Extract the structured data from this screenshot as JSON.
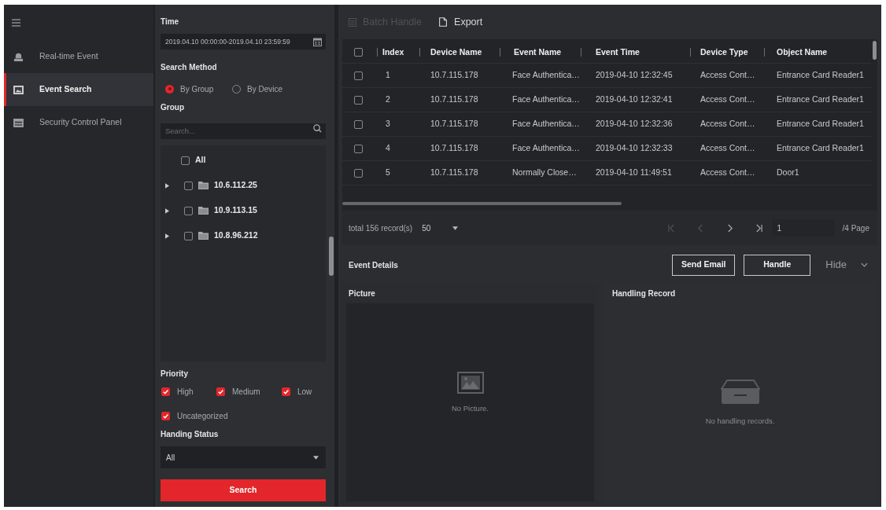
{
  "sidebar": {
    "items": [
      {
        "label": "Real-time Event",
        "selected": false
      },
      {
        "label": "Event Search",
        "selected": true
      },
      {
        "label": "Security Control Panel",
        "selected": false
      }
    ]
  },
  "filters": {
    "time": {
      "label": "Time",
      "value": "2019.04.10 00:00:00-2019.04.10 23:59:59"
    },
    "search_method": {
      "label": "Search Method",
      "options": [
        {
          "label": "By Group",
          "selected": true
        },
        {
          "label": "By Device",
          "selected": false
        }
      ]
    },
    "group": {
      "label": "Group",
      "search": {
        "placeholder": "Search..."
      },
      "all": {
        "label": "All",
        "checked": false
      },
      "nodes": [
        {
          "label": "10.6.112.25",
          "checked": false,
          "expanded": false
        },
        {
          "label": "10.9.113.15",
          "checked": false,
          "expanded": false
        },
        {
          "label": "10.8.96.212",
          "checked": false,
          "expanded": false
        }
      ]
    },
    "priority": {
      "label": "Priority",
      "options": [
        {
          "label": "High",
          "checked": true
        },
        {
          "label": "Medium",
          "checked": true
        },
        {
          "label": "Low",
          "checked": true
        },
        {
          "label": "Uncategorized",
          "checked": true
        }
      ]
    },
    "handling_status": {
      "label": "Handing Status",
      "value": "All"
    },
    "search_button": "Search"
  },
  "toolbar": {
    "buttons": [
      {
        "label": "Batch Handle",
        "disabled": true
      },
      {
        "label": "Export",
        "disabled": false
      }
    ]
  },
  "table": {
    "select_all": {
      "checked": false
    },
    "columns": [
      "Index",
      "Device Name",
      "Event Name",
      "Event Time",
      "Device Type",
      "Object Name"
    ],
    "rows": [
      {
        "checked": false,
        "cells": [
          "1",
          "10.7.115.178",
          "Face Authentica…",
          "2019-04-10 12:32:45",
          "Access Cont…",
          "Entrance Card Reader1"
        ]
      },
      {
        "checked": false,
        "cells": [
          "2",
          "10.7.115.178",
          "Face Authentica…",
          "2019-04-10 12:32:41",
          "Access Cont…",
          "Entrance Card Reader1"
        ]
      },
      {
        "checked": false,
        "cells": [
          "3",
          "10.7.115.178",
          "Face Authentica…",
          "2019-04-10 12:32:36",
          "Access Cont…",
          "Entrance Card Reader1"
        ]
      },
      {
        "checked": false,
        "cells": [
          "4",
          "10.7.115.178",
          "Face Authentica…",
          "2019-04-10 12:32:33",
          "Access Cont…",
          "Entrance Card Reader1"
        ]
      },
      {
        "checked": false,
        "cells": [
          "5",
          "10.7.115.178",
          "Normally Close…",
          "2019-04-10 11:49:51",
          "Access Cont…",
          "Door1"
        ]
      }
    ]
  },
  "pagination": {
    "total": "total 156 record(s)",
    "page_size": "50",
    "nav": [
      {
        "kind": "first",
        "disabled": true
      },
      {
        "kind": "prev",
        "disabled": true
      },
      {
        "kind": "next",
        "disabled": false
      },
      {
        "kind": "last",
        "disabled": false
      }
    ],
    "page": "1",
    "page_count": "/4 Page"
  },
  "details": {
    "title": "Event Details",
    "buttons": [
      "Send Email",
      "Handle"
    ],
    "hide": "Hide",
    "picture": {
      "title": "Picture",
      "empty": "No Picture."
    },
    "handling_record": {
      "title": "Handling Record",
      "empty": "No handling records."
    }
  }
}
